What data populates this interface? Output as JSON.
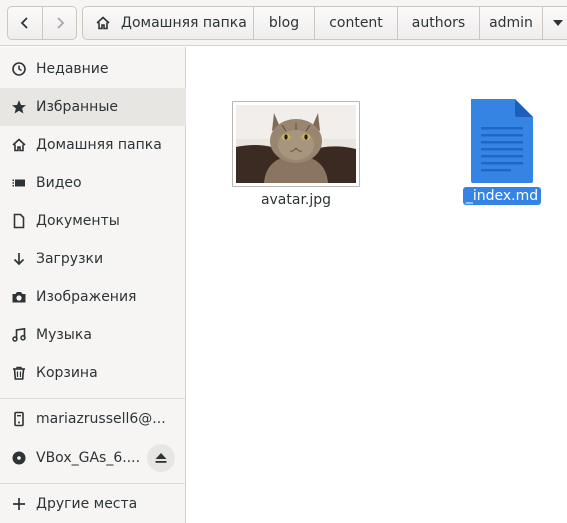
{
  "colors": {
    "accent": "#3584e4",
    "sidebar_bg": "#f6f5f4",
    "text": "#2e3436"
  },
  "navigation": {
    "back_icon": "chevron-left-icon",
    "forward_icon": "chevron-right-icon"
  },
  "pathbar": {
    "home_icon": "home-icon",
    "home_label": "Домашняя папка",
    "segments": [
      "blog",
      "content",
      "authors",
      "admin"
    ],
    "overflow_icon": "triangle-down-icon"
  },
  "sidebar": {
    "places": [
      {
        "label": "Недавние",
        "icon": "clock-icon"
      },
      {
        "label": "Избранные",
        "icon": "star-icon"
      },
      {
        "label": "Домашняя папка",
        "icon": "home-icon"
      },
      {
        "label": "Видео",
        "icon": "video-icon"
      },
      {
        "label": "Документы",
        "icon": "document-icon"
      },
      {
        "label": "Загрузки",
        "icon": "download-icon"
      },
      {
        "label": "Изображения",
        "icon": "camera-icon"
      },
      {
        "label": "Музыка",
        "icon": "music-icon"
      },
      {
        "label": "Корзина",
        "icon": "trash-icon"
      }
    ],
    "devices": [
      {
        "label": "mariazrussell6@...",
        "icon": "computer-icon"
      },
      {
        "label": "VBox_GAs_6....",
        "icon": "disc-icon",
        "eject_icon": "eject-icon"
      }
    ],
    "other": {
      "label": "Другие места",
      "icon": "plus-icon"
    }
  },
  "files": [
    {
      "name": "avatar.jpg",
      "kind": "image-thumbnail"
    },
    {
      "name": "_index.md",
      "kind": "text-document",
      "selected": true
    }
  ]
}
